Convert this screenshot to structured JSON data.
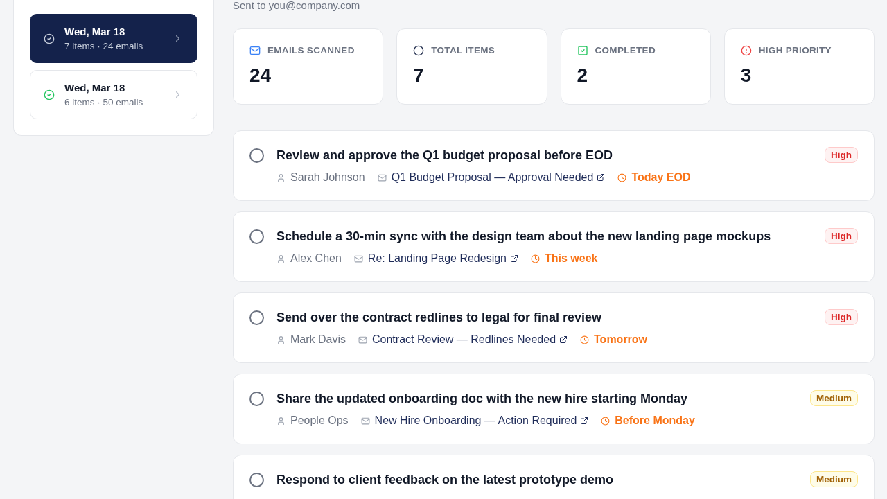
{
  "header": {
    "subtitle": "Sent to you@company.com"
  },
  "sidebar": {
    "digests": [
      {
        "date": "Wed, Mar 18",
        "summary": "7 items · 24 emails",
        "selected": true
      },
      {
        "date": "Wed, Mar 18",
        "summary": "6 items · 50 emails",
        "selected": false
      }
    ]
  },
  "stats": [
    {
      "kind": "emails",
      "label": "EMAILS SCANNED",
      "value": "24"
    },
    {
      "kind": "total",
      "label": "TOTAL ITEMS",
      "value": "7"
    },
    {
      "kind": "completed",
      "label": "COMPLETED",
      "value": "2"
    },
    {
      "kind": "priority",
      "label": "HIGH PRIORITY",
      "value": "3"
    }
  ],
  "tasks": [
    {
      "title": "Review and approve the Q1 budget proposal before EOD",
      "checked": false,
      "from": "Sarah Johnson",
      "subject": "Q1 Budget Proposal — Approval Needed",
      "due": "Today EOD",
      "badge": {
        "text": "High",
        "kind": "high"
      }
    },
    {
      "title": "Schedule a 30-min sync with the design team about the new landing page mockups",
      "checked": false,
      "from": "Alex Chen",
      "subject": "Re: Landing Page Redesign",
      "due": "This week",
      "badge": {
        "text": "High",
        "kind": "high"
      }
    },
    {
      "title": "Send over the contract redlines to legal for final review",
      "checked": false,
      "from": "Mark Davis",
      "subject": "Contract Review — Redlines Needed",
      "due": "Tomorrow",
      "badge": {
        "text": "High",
        "kind": "high"
      }
    },
    {
      "title": "Share the updated onboarding doc with the new hire starting Monday",
      "checked": false,
      "from": "People Ops",
      "subject": "New Hire Onboarding — Action Required",
      "due": "Before Monday",
      "badge": {
        "text": "Medium",
        "kind": "medium"
      }
    },
    {
      "title": "Respond to client feedback on the latest prototype demo",
      "checked": false,
      "badge": {
        "text": "Medium",
        "kind": "medium"
      }
    }
  ]
}
